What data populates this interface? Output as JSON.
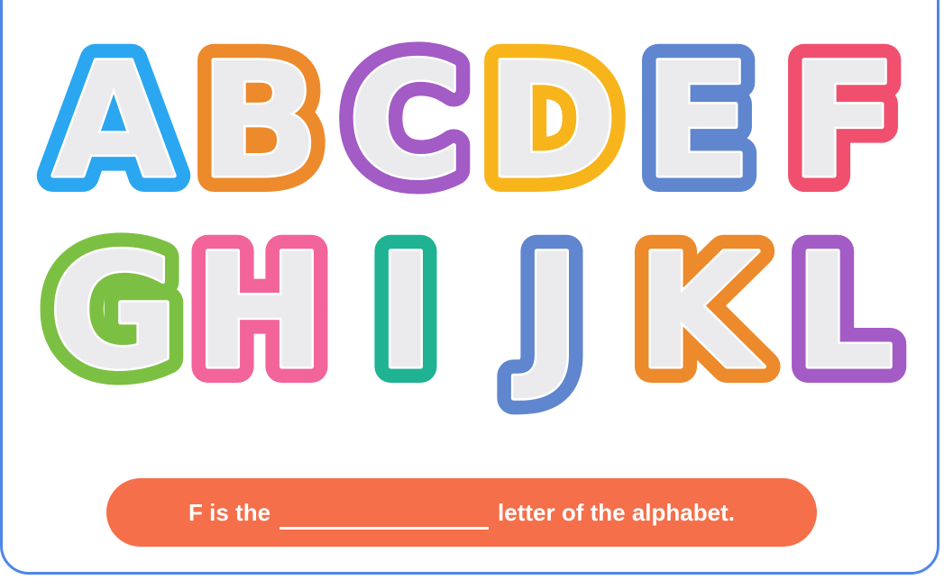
{
  "rows": [
    [
      {
        "letter": "A",
        "color": "#2aa7f0"
      },
      {
        "letter": "B",
        "color": "#ec8a2c"
      },
      {
        "letter": "C",
        "color": "#a35bc6"
      },
      {
        "letter": "D",
        "color": "#f7b51b"
      },
      {
        "letter": "E",
        "color": "#5f86cf"
      },
      {
        "letter": "F",
        "color": "#f0506e"
      }
    ],
    [
      {
        "letter": "G",
        "color": "#7cc043"
      },
      {
        "letter": "H",
        "color": "#f2649a"
      },
      {
        "letter": "I",
        "color": "#1fb393"
      },
      {
        "letter": "J",
        "color": "#5f86cf"
      },
      {
        "letter": "K",
        "color": "#ec8a2c"
      },
      {
        "letter": "L",
        "color": "#a35bc6"
      }
    ]
  ],
  "banner": {
    "prefix": "F is the",
    "suffix": "letter of the alphabet.",
    "color": "#f46f4a"
  },
  "frame": {
    "border_color": "#4f86e8"
  }
}
